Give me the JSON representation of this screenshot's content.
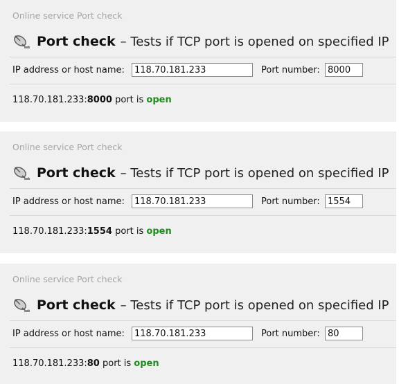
{
  "colors": {
    "panel_background": "#f0f0f0",
    "breadcrumb": "#a6a6a6",
    "status_open": "#1e8c1e"
  },
  "panels": [
    {
      "breadcrumb": "Online service Port check",
      "title_icon": "satellite-dish-icon",
      "title_strong": "Port check",
      "title_rest": "– Tests if TCP port is opened on specified IP",
      "ip_label": "IP address or host name:",
      "ip_value": "118.70.181.233",
      "port_label": "Port number:",
      "port_value": "8000",
      "result_host": "118.70.181.233:",
      "result_port": "8000",
      "result_middle": " port is ",
      "result_status": "open"
    },
    {
      "breadcrumb": "Online service Port check",
      "title_icon": "satellite-dish-icon",
      "title_strong": "Port check",
      "title_rest": "– Tests if TCP port is opened on specified IP",
      "ip_label": "IP address or host name:",
      "ip_value": "118.70.181.233",
      "port_label": "Port number:",
      "port_value": "1554",
      "result_host": "118.70.181.233:",
      "result_port": "1554",
      "result_middle": " port is ",
      "result_status": "open"
    },
    {
      "breadcrumb": "Online service Port check",
      "title_icon": "satellite-dish-icon",
      "title_strong": "Port check",
      "title_rest": "– Tests if TCP port is opened on specified IP",
      "ip_label": "IP address or host name:",
      "ip_value": "118.70.181.233",
      "port_label": "Port number:",
      "port_value": "80",
      "result_host": "118.70.181.233:",
      "result_port": "80",
      "result_middle": " port is ",
      "result_status": "open"
    }
  ]
}
